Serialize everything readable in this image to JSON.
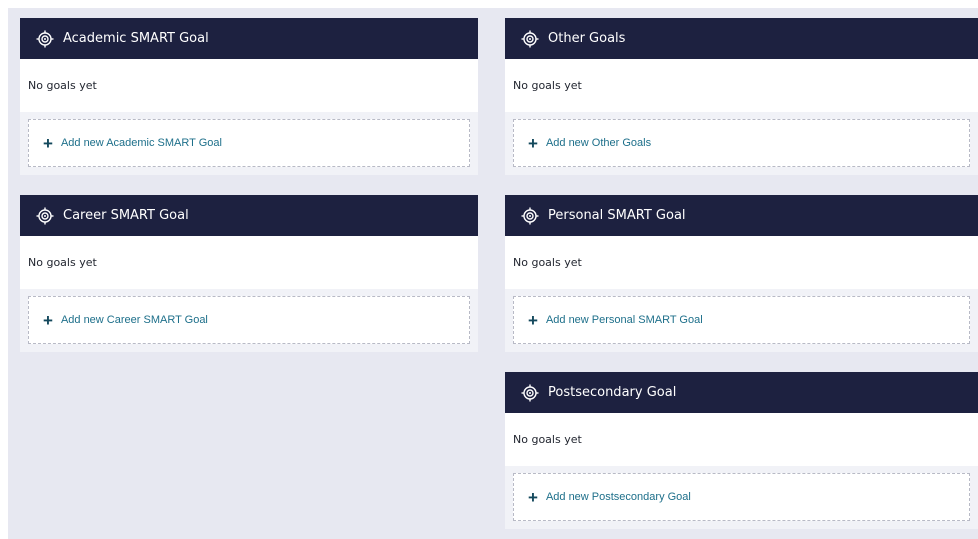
{
  "empty_text": "No goals yet",
  "colors": {
    "header": "#1d2140",
    "canvas": "#e7e8f1",
    "link": "#1d6f8a"
  },
  "icons": {
    "header": "target-icon",
    "add": "plus-icon"
  },
  "cards": [
    {
      "title": "Academic SMART Goal",
      "empty": "No goals yet",
      "add_label": "Add new Academic SMART Goal"
    },
    {
      "title": "Career SMART Goal",
      "empty": "No goals yet",
      "add_label": "Add new Career SMART Goal"
    },
    {
      "title": "Other Goals",
      "empty": "No goals yet",
      "add_label": "Add new Other Goals"
    },
    {
      "title": "Personal SMART Goal",
      "empty": "No goals yet",
      "add_label": "Add new Personal SMART Goal"
    },
    {
      "title": "Postsecondary Goal",
      "empty": "No goals yet",
      "add_label": "Add new Postsecondary Goal"
    }
  ]
}
